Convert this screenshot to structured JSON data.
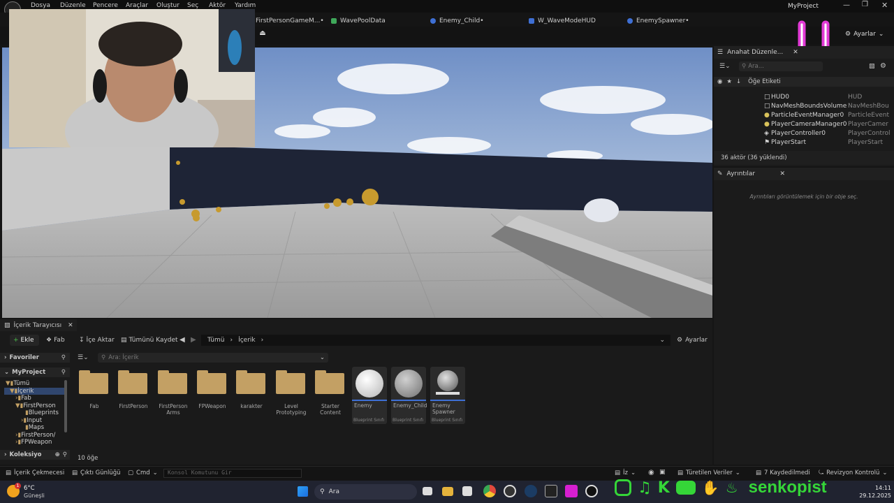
{
  "window": {
    "title": "MyProject"
  },
  "menu": [
    "Dosya",
    "Düzenle",
    "Pencere",
    "Araçlar",
    "Oluştur",
    "Seç",
    "Aktör",
    "Yardım"
  ],
  "tabs": [
    {
      "label": "FirstPersonGameM...•",
      "color": "#d9d9d9"
    },
    {
      "label": "WavePoolData",
      "color": "#3fa85a"
    },
    {
      "label": "Enemy_Child•",
      "color": "#3e6fd4"
    },
    {
      "label": "W_WaveModeHUD",
      "color": "#3e6fd4"
    },
    {
      "label": "EnemySpawner•",
      "color": "#3e6fd4"
    }
  ],
  "toolbar": {
    "settings_label": "Ayarlar"
  },
  "outliner": {
    "tab_label": "Anahat Düzenle...",
    "search_placeholder": "Ara...",
    "column_label": "Öğe Etiketi",
    "rows": [
      {
        "label": "HUD0",
        "type": "HUD"
      },
      {
        "label": "NavMeshBoundsVolume",
        "type": "NavMeshBou"
      },
      {
        "label": "ParticleEventManager0",
        "type": "ParticleEvent"
      },
      {
        "label": "PlayerCameraManager0",
        "type": "PlayerCamer"
      },
      {
        "label": "PlayerController0",
        "type": "PlayerControl"
      },
      {
        "label": "PlayerStart",
        "type": "PlayerStart"
      }
    ],
    "count": "36 aktör (36 yüklendi)"
  },
  "details": {
    "tab_label": "Ayrıntılar",
    "empty_text": "Ayrıntıları görüntülemek için bir obje seç."
  },
  "content_browser": {
    "tab_label": "İçerik Tarayıcısı",
    "add_label": "Ekle",
    "fab_label": "Fab",
    "import_label": "İçe Aktar",
    "save_all_label": "Tümünü Kaydet",
    "breadcrumb": [
      "Tümü",
      "İçerik"
    ],
    "settings_label": "Ayarlar",
    "search_placeholder": "Ara: İçerik",
    "favorites_label": "Favoriler",
    "project_label": "MyProject",
    "collections_label": "Koleksiyo",
    "tree": [
      "Tümü",
      "İçerik",
      "Fab",
      "FirstPerson",
      "Blueprints",
      "Input",
      "Maps",
      "FirstPerson/",
      "FPWeapon"
    ],
    "folders": [
      "Fab",
      "FirstPerson",
      "FirstPerson Arms",
      "FPWeapon",
      "karakter",
      "Level Prototyping",
      "Starter Content"
    ],
    "assets": [
      {
        "name": "Enemy",
        "kind": "Blueprint Sınıfı"
      },
      {
        "name": "Enemy_Child",
        "kind": "Blueprint Sınıfı"
      },
      {
        "name": "Enemy Spawner",
        "kind": "Blueprint Sınıfı"
      }
    ],
    "item_count": "10 öğe"
  },
  "statusbar": {
    "drawer_label": "İçerik Çekmecesi",
    "output_label": "Çıktı Günlüğü",
    "cmd_label": "Cmd",
    "console_placeholder": "Konsol Komutunu Gir",
    "derived_label": "Türetilen Veriler",
    "saved_label": "7 Kaydedilmedi",
    "revision_label": "Revizyon Kontrolü",
    "iz_label": "İz"
  },
  "taskbar": {
    "weather_temp": "6°C",
    "weather_desc": "Güneşli",
    "weather_badge": "1",
    "search_placeholder": "Ara",
    "time": "14:11",
    "date": "29.12.2025"
  },
  "overlay": {
    "brand": "senkopist"
  }
}
